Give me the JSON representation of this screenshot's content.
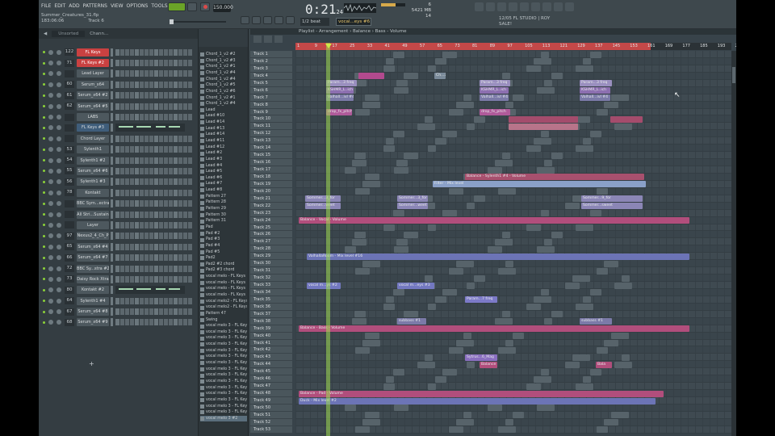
{
  "app": {
    "menu": [
      "FILE",
      "EDIT",
      "ADD",
      "PATTERNS",
      "VIEW",
      "OPTIONS",
      "TOOLS",
      "HELP"
    ],
    "song_name": "Summer_Creatures_31.flp",
    "song_time": "183:06:06",
    "track_label": "Track 6",
    "bpm": "150.000",
    "clock": "0:21",
    "clock_sub": "24",
    "cpu": "6",
    "ram": "5421 MB",
    "ram_sub": "14",
    "snap": "1/2 beat",
    "pattern": "vocal...eys #6",
    "hint_line1": "12/05  FL STUDIO | ROY",
    "hint_line2": "SALE!"
  },
  "channel_rack": {
    "filter": "Unsorted",
    "title": "Chann...",
    "add_label": "+",
    "channels": [
      {
        "num": "122",
        "name": "FL Keys",
        "style": "sel",
        "roll": false
      },
      {
        "num": "71",
        "name": "FL Keys #2",
        "style": "sel",
        "roll": false
      },
      {
        "num": "",
        "name": "Lead Layer",
        "style": "",
        "roll": false
      },
      {
        "num": "60",
        "name": "Serum_x64",
        "style": "",
        "roll": false
      },
      {
        "num": "61",
        "name": "Serum_x64 #2",
        "style": "",
        "roll": false
      },
      {
        "num": "62",
        "name": "Serum_x64 #5",
        "style": "",
        "roll": false
      },
      {
        "num": "",
        "name": "LABS",
        "style": "",
        "roll": false
      },
      {
        "num": "",
        "name": "FL Keys #3",
        "style": "alt",
        "roll": true
      },
      {
        "num": "",
        "name": "Chord Layer",
        "style": "",
        "roll": false
      },
      {
        "num": "53",
        "name": "Sylenth1",
        "style": "",
        "roll": false
      },
      {
        "num": "54",
        "name": "Sylenth1 #2",
        "style": "",
        "roll": false
      },
      {
        "num": "55",
        "name": "Serum_x64 #6",
        "style": "",
        "roll": false
      },
      {
        "num": "56",
        "name": "Sylenth1 #3",
        "style": "",
        "roll": false
      },
      {
        "num": "78",
        "name": "Kontakt",
        "style": "",
        "roll": false
      },
      {
        "num": "",
        "name": "BBC Sym...ectra",
        "style": "",
        "roll": false
      },
      {
        "num": "",
        "name": "All Stri...Sustain",
        "style": "",
        "roll": false
      },
      {
        "num": "",
        "name": "Layer",
        "style": "",
        "roll": false
      },
      {
        "num": "97",
        "name": "Nexus2_4_Ch_P",
        "style": "",
        "roll": false
      },
      {
        "num": "65",
        "name": "Serum_x64 #4",
        "style": "",
        "roll": false
      },
      {
        "num": "66",
        "name": "Serum_x64 #7",
        "style": "",
        "roll": false
      },
      {
        "num": "72",
        "name": "BBC Sy...stra #2",
        "style": "",
        "roll": false
      },
      {
        "num": "73",
        "name": "Daisy Rock Xtra",
        "style": "",
        "roll": false
      },
      {
        "num": "80",
        "name": "Kontakt #2",
        "style": "",
        "roll": true
      },
      {
        "num": "64",
        "name": "Sylenth1 #4",
        "style": "",
        "roll": false
      },
      {
        "num": "67",
        "name": "Serum_x64 #8",
        "style": "",
        "roll": false
      },
      {
        "num": "68",
        "name": "Serum_x64 #9",
        "style": "",
        "roll": false
      }
    ]
  },
  "browser": {
    "items": [
      "Chord_1_v2 #2",
      "Chord_1_v2 #3",
      "Chord_1_v2 #1",
      "Chord_1_v2 #4",
      "Chord_1_v2 #4",
      "Chord_1_v2 #5",
      "Chord_1_v2 #6",
      "Chord_1_v2 #1",
      "Chord_1_v2 #4",
      "Lead",
      "Lead #10",
      "Lead #14",
      "Lead #13",
      "Lead #14",
      "Lead #11",
      "Lead #12",
      "Lead #2",
      "Lead #3",
      "Lead #4",
      "Lead #5",
      "Lead #6",
      "Lead #7",
      "Lead #8",
      "Pattern 27",
      "Pattern 28",
      "Pattern 29",
      "Pattern 30",
      "Pattern 31",
      "Pad",
      "Pad #2",
      "Pad #3",
      "Pad #4",
      "Pad #5",
      "Pad2",
      "Pad2 #2 chord",
      "Pad2 #3 chord",
      "vocal melo - FL Keys",
      "vocal melo - FL Keys",
      "vocal melo - FL Keys",
      "vocal melo - FL Keys",
      "vocal melo2 - FL Keys",
      "vocal melo2 - FL Keys",
      "Pattern 47",
      "Swing",
      "vocal melo 3 - FL Keys",
      "vocal melo 3 - FL Keys",
      "vocal melo 3 - FL Keys",
      "vocal melo 3 - FL Keys",
      "vocal melo 3 - FL Keys",
      "vocal melo 3 - FL Keys",
      "vocal melo 3 - FL Keys",
      "vocal melo 3 - FL Keys",
      "vocal melo 3 - FL Keys",
      "vocal melo 3 - FL Keys",
      "vocal melo 3 - FL Keys",
      "vocal melo 3 - FL Keys",
      "vocal melo 3 - FL Keys",
      "vocal melo 3 - FL Keys",
      "vocal melo 3 - FL Keys",
      "vocal melo 3 #2"
    ]
  },
  "playlist": {
    "title": "Playlist - Arrangement › Balance › Bass - Volume",
    "ruler": [
      "1",
      "9",
      "17",
      "25",
      "33",
      "41",
      "49",
      "57",
      "65",
      "73",
      "81",
      "89",
      "97",
      "105",
      "113",
      "121",
      "129",
      "137",
      "145",
      "153",
      "161",
      "169",
      "177",
      "185",
      "193",
      "201"
    ],
    "tracks": [
      "Track 1",
      "Track 2",
      "Track 3",
      "Track 4",
      "Track 5",
      "Track 6",
      "Track 7",
      "Track 8",
      "Track 9",
      "Track 10",
      "Track 11",
      "Track 12",
      "Track 13",
      "Track 14",
      "Track 15",
      "Track 16",
      "Track 17",
      "Track 18",
      "Track 19",
      "Track 20",
      "Track 21",
      "Track 22",
      "Track 23",
      "Track 24",
      "Track 25",
      "Track 26",
      "Track 27",
      "Track 28",
      "Track 29",
      "Track 30",
      "Track 31",
      "Track 32",
      "Track 33",
      "Track 34",
      "Track 35",
      "Track 36",
      "Track 37",
      "Track 38",
      "Track 39",
      "Track 40",
      "Track 41",
      "Track 42",
      "Track 43",
      "Track 44",
      "Track 45",
      "Track 46",
      "Track 47",
      "Track 48",
      "Track 49",
      "Track 50",
      "Track 51",
      "Track 52",
      "Track 53"
    ],
    "clips": [
      {
        "t": 3,
        "s": 78,
        "e": 110,
        "c": "#b24a8e",
        "l": ""
      },
      {
        "t": 3,
        "s": 172,
        "e": 186,
        "c": "#7a8a99",
        "l": "Ch...3"
      },
      {
        "t": 4,
        "s": 38,
        "e": 76,
        "c": "#9a8fbf",
        "l": "Param...3 freq"
      },
      {
        "t": 4,
        "s": 228,
        "e": 266,
        "c": "#9a8fbf",
        "l": "Param...3 freq"
      },
      {
        "t": 4,
        "s": 352,
        "e": 392,
        "c": "#9a8fbf",
        "l": "Param...3 freq"
      },
      {
        "t": 5,
        "s": 38,
        "e": 72,
        "c": "#8c6fb0",
        "l": "KSHMR_L..ich"
      },
      {
        "t": 5,
        "s": 228,
        "e": 264,
        "c": "#8c6fb0",
        "l": "KSHMR_L..ich"
      },
      {
        "t": 5,
        "s": 352,
        "e": 390,
        "c": "#8c6fb0",
        "l": "KSHMR_L..ich"
      },
      {
        "t": 6,
        "s": 38,
        "e": 72,
        "c": "#7b7aa8",
        "l": "Valhall...ivl #4"
      },
      {
        "t": 6,
        "s": 228,
        "e": 264,
        "c": "#7b7aa8",
        "l": "Valhall...ivl #4"
      },
      {
        "t": 6,
        "s": 352,
        "e": 390,
        "c": "#7b7aa8",
        "l": "Valhall...ivl #4"
      },
      {
        "t": 8,
        "s": 38,
        "e": 70,
        "c": "#b05a9a",
        "l": "drop_fx_pitch"
      },
      {
        "t": 8,
        "s": 228,
        "e": 266,
        "c": "#b05a9a",
        "l": "drop_fx_pitch"
      },
      {
        "t": 9,
        "s": 264,
        "e": 350,
        "c": "#a44c6c",
        "l": ""
      },
      {
        "t": 9,
        "s": 390,
        "e": 430,
        "c": "#a44c6c",
        "l": ""
      },
      {
        "t": 10,
        "s": 264,
        "e": 350,
        "c": "#b8748a",
        "l": ""
      },
      {
        "t": 17,
        "s": 210,
        "e": 432,
        "c": "#a8506e",
        "l": "Balance - Sylenth1 #4 - Volume"
      },
      {
        "t": 18,
        "s": 170,
        "e": 434,
        "c": "#8aa0c8",
        "l": "Filter - Mix level"
      },
      {
        "t": 20,
        "s": 12,
        "e": 56,
        "c": "#8b86b6",
        "l": "Sommer...3_for"
      },
      {
        "t": 20,
        "s": 126,
        "e": 164,
        "c": "#8b86b6",
        "l": "Sommer...3_for"
      },
      {
        "t": 20,
        "s": 354,
        "e": 430,
        "c": "#8b86b6",
        "l": "Sommer...9_for"
      },
      {
        "t": 21,
        "s": 12,
        "e": 56,
        "c": "#8b86b6",
        "l": "Sommer...weet"
      },
      {
        "t": 21,
        "s": 126,
        "e": 164,
        "c": "#8b86b6",
        "l": "Sommer...weet"
      },
      {
        "t": 21,
        "s": 354,
        "e": 430,
        "c": "#8b86b6",
        "l": "Sommer...sweet"
      },
      {
        "t": 23,
        "s": 4,
        "e": 488,
        "c": "#b14e7c",
        "l": "Balance - Vocal - Volume"
      },
      {
        "t": 28,
        "s": 14,
        "e": 488,
        "c": "#6c74b6",
        "l": "ValhallaRoom - Mix level #16"
      },
      {
        "t": 32,
        "s": 14,
        "e": 56,
        "c": "#7378c0",
        "l": "vocal m...ys #2"
      },
      {
        "t": 32,
        "s": 126,
        "e": 172,
        "c": "#7378c0",
        "l": "vocal m...eys #3"
      },
      {
        "t": 34,
        "s": 210,
        "e": 250,
        "c": "#7c7ac8",
        "l": "Param...7 freq"
      },
      {
        "t": 37,
        "s": 126,
        "e": 162,
        "c": "#7b7aa8",
        "l": "subbass #1"
      },
      {
        "t": 37,
        "s": 352,
        "e": 392,
        "c": "#7b7aa8",
        "l": "subbass #1"
      },
      {
        "t": 38,
        "s": 4,
        "e": 488,
        "c": "#b14e7c",
        "l": "Balance - Bass - Volume"
      },
      {
        "t": 42,
        "s": 210,
        "e": 250,
        "c": "#8a6fc0",
        "l": "Sytrus...6_Mag"
      },
      {
        "t": 43,
        "s": 228,
        "e": 250,
        "c": "#b14e7c",
        "l": "Balance - ome"
      },
      {
        "t": 43,
        "s": 372,
        "e": 392,
        "c": "#b14e7c",
        "l": "Bala"
      },
      {
        "t": 47,
        "s": 4,
        "e": 456,
        "c": "#b14e7c",
        "l": "Balance - Pad - Volume"
      },
      {
        "t": 48,
        "s": 4,
        "e": 446,
        "c": "#6c74b6",
        "l": "Duck - Mix level #2"
      }
    ]
  }
}
